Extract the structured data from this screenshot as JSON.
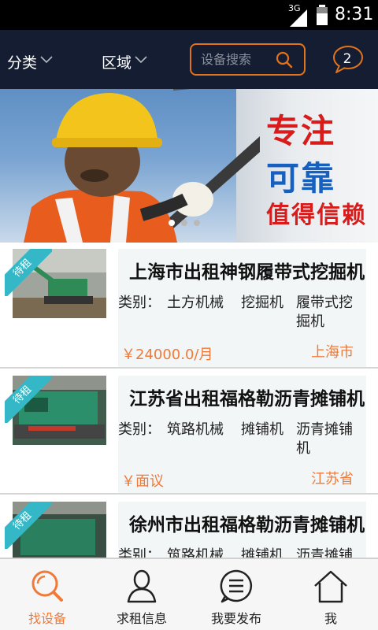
{
  "status_bar": {
    "network": "3G",
    "time": "8:31"
  },
  "top_nav": {
    "category_label": "分类",
    "region_label": "区域",
    "search_placeholder": "设备搜索",
    "message_count": "2"
  },
  "banner": {
    "line1": "专注",
    "line2": "可靠",
    "line3": "值得信赖",
    "slide_count": 3,
    "active_slide": 0
  },
  "listings": [
    {
      "badge": "待租",
      "title": "上海市出租神钢履带式挖掘机",
      "category_label": "类别：",
      "cat1": "土方机械",
      "cat2": "挖掘机",
      "cat3": "履带式挖掘机",
      "price": "￥24000.0/月",
      "location": "上海市"
    },
    {
      "badge": "待租",
      "title": "江苏省出租福格勒沥青摊铺机",
      "category_label": "类别：",
      "cat1": "筑路机械",
      "cat2": "摊铺机",
      "cat3": "沥青摊铺机",
      "price": "￥面议",
      "location": "江苏省"
    },
    {
      "badge": "待租",
      "title": "徐州市出租福格勒沥青摊铺机",
      "category_label": "类别：",
      "cat1": "筑路机械",
      "cat2": "摊铺机",
      "cat3": "沥青摊铺机",
      "price": "",
      "location": ""
    }
  ],
  "tabs": [
    {
      "label": "找设备",
      "icon": "search-icon",
      "active": true
    },
    {
      "label": "求租信息",
      "icon": "user-icon",
      "active": false
    },
    {
      "label": "我要发布",
      "icon": "message-icon",
      "active": false
    },
    {
      "label": "我",
      "icon": "home-icon",
      "active": false
    }
  ],
  "colors": {
    "accent": "#ef7a39",
    "nav_bg": "#141d32",
    "search_border": "#e2731a",
    "badge": "#34b8c7"
  }
}
